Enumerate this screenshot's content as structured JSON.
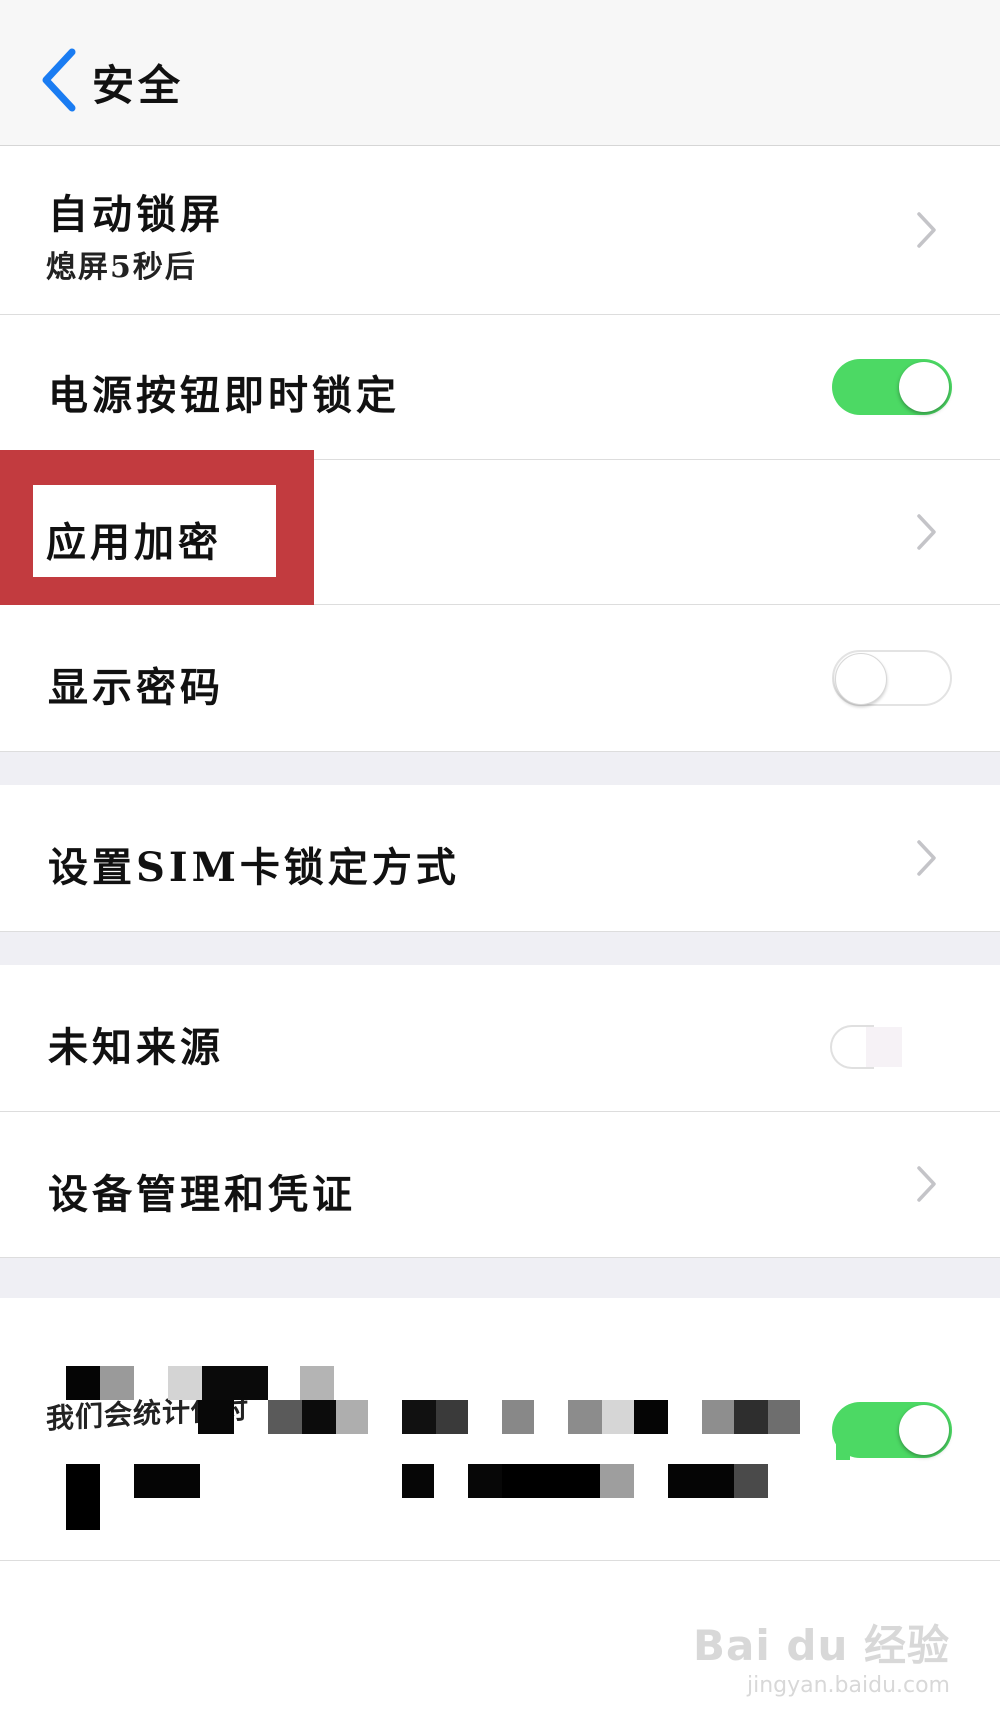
{
  "nav": {
    "title": "安全"
  },
  "rows": {
    "auto_lock": {
      "label": "自动锁屏",
      "value": "熄屏5秒后"
    },
    "power_lock": {
      "label": "电源按钮即时锁定",
      "toggle": "on"
    },
    "app_encrypt": {
      "label": "应用加密"
    },
    "show_password": {
      "label": "显示密码",
      "toggle": "off"
    },
    "sim_lock": {
      "label": "设置SIM卡锁定方式"
    },
    "unknown_sources": {
      "label": "未知来源"
    },
    "device_mgmt": {
      "label": "设备管理和凭证"
    },
    "stats": {
      "label_fragment": "我们会统计你对",
      "toggle": "on"
    }
  },
  "colors": {
    "accent_blue": "#1a7cf2",
    "toggle_green": "#4cd964",
    "highlight_red": "#c23b3f"
  },
  "watermark": {
    "logo": "Bai du 经验",
    "url": "jingyan.baidu.com"
  }
}
